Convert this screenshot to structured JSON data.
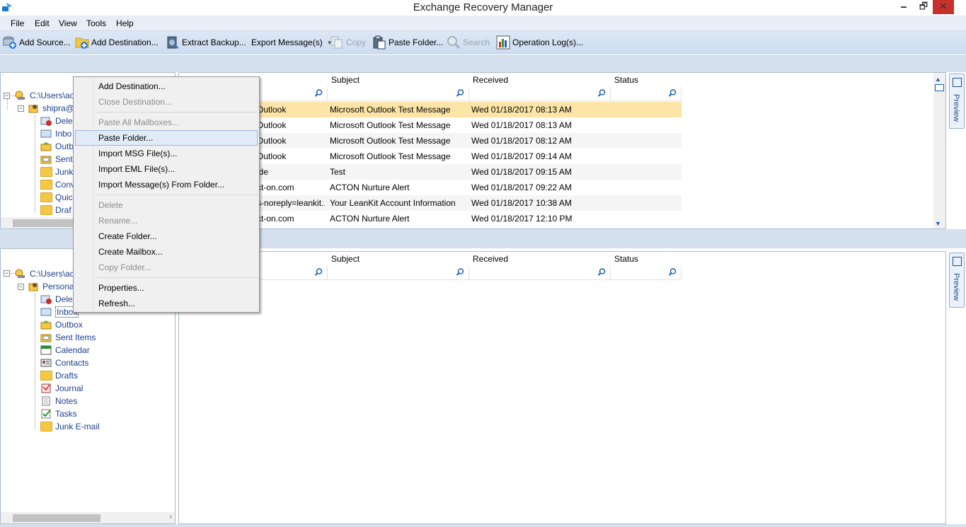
{
  "window": {
    "title": "Exchange Recovery Manager",
    "min": "🗕",
    "max": "🗗",
    "close": "✕"
  },
  "menubar": [
    "File",
    "Edit",
    "View",
    "Tools",
    "Help"
  ],
  "toolbar": {
    "add_source": "Add Source...",
    "add_destination": "Add Destination...",
    "extract_backup": "Extract Backup...",
    "export_messages": "Export Message(s)",
    "copy": "Copy",
    "paste_folder": "Paste Folder...",
    "search": "Search",
    "operation_logs": "Operation Log(s)..."
  },
  "top_tree": {
    "root": "C:\\Users\\ac",
    "mailbox": "shipra@",
    "folders": [
      "Dele",
      "Inbo",
      "Outb",
      "Sent",
      "Junk",
      "Conv",
      "Quic",
      "Draf"
    ]
  },
  "bottom_tree": {
    "root": "C:\\Users\\ac",
    "mailbox": "Persona",
    "folders": [
      "Dele",
      "Inbox",
      "Outbox",
      "Sent Items",
      "Calendar",
      "Contacts",
      "Drafts",
      "Journal",
      "Notes",
      "Tasks",
      "Junk E-mail"
    ]
  },
  "grid": {
    "headers": {
      "subject": "Subject",
      "received": "Received",
      "status": "Status"
    },
    "rows": [
      {
        "from": "Outlook",
        "subject": "Microsoft Outlook Test Message",
        "received": "Wed 01/18/2017 08:13 AM",
        "status": ""
      },
      {
        "from": "Outlook",
        "subject": "Microsoft Outlook Test Message",
        "received": "Wed 01/18/2017 08:13 AM",
        "status": ""
      },
      {
        "from": "Outlook",
        "subject": "Microsoft Outlook Test Message",
        "received": "Wed 01/18/2017 08:12 AM",
        "status": ""
      },
      {
        "from": "Outlook",
        "subject": "Microsoft Outlook Test Message",
        "received": "Wed 01/18/2017 09:14 AM",
        "status": ""
      },
      {
        "from": "ide",
        "subject": "Test",
        "received": "Wed 01/18/2017 09:15 AM",
        "status": ""
      },
      {
        "from": "ct-on.com",
        "subject": "ACTON Nurture Alert",
        "received": "Wed 01/18/2017 09:22 AM",
        "status": ""
      },
      {
        "from": "s-noreply=leankit...",
        "subject": "Your LeanKit Account Information",
        "received": "Wed 01/18/2017 10:38 AM",
        "status": ""
      },
      {
        "from": "ct-on.com",
        "subject": "ACTON Nurture Alert",
        "received": "Wed 01/18/2017 12:10 PM",
        "status": ""
      }
    ]
  },
  "preview_label": "Preview",
  "context_menu": [
    {
      "label": "Add Destination...",
      "enabled": true
    },
    {
      "label": "Close Destination...",
      "enabled": false
    },
    {
      "sep": true
    },
    {
      "label": "Paste All Mailboxes...",
      "enabled": false
    },
    {
      "label": "Paste Folder...",
      "enabled": true,
      "hover": true
    },
    {
      "label": "Import MSG File(s)...",
      "enabled": true
    },
    {
      "label": "Import EML File(s)...",
      "enabled": true
    },
    {
      "label": "Import Message(s) From Folder...",
      "enabled": true
    },
    {
      "sep": true
    },
    {
      "label": "Delete",
      "enabled": false
    },
    {
      "label": "Rename...",
      "enabled": false
    },
    {
      "label": "Create Folder...",
      "enabled": true
    },
    {
      "label": "Create Mailbox...",
      "enabled": true
    },
    {
      "label": "Copy Folder...",
      "enabled": false
    },
    {
      "sep": true
    },
    {
      "label": "Properties...",
      "enabled": true
    },
    {
      "label": "Refresh...",
      "enabled": true
    }
  ]
}
